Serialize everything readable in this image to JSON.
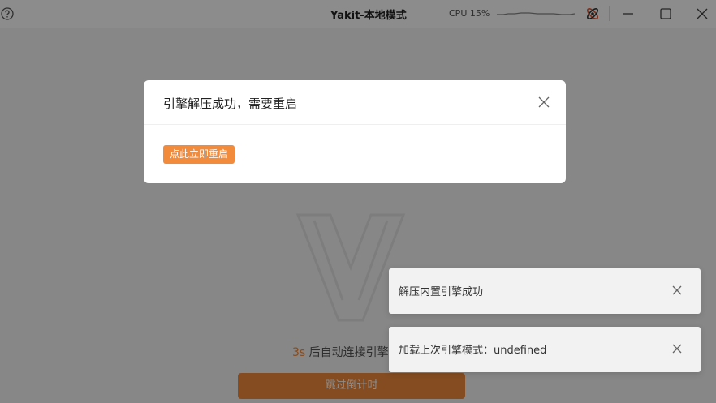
{
  "titlebar": {
    "app_title": "Yakit-本地模式",
    "cpu_label": "CPU 15%",
    "icons": {
      "help": "help-circle-icon",
      "engine": "engine-status-icon",
      "minimize": "minimize-icon",
      "maximize": "maximize-icon",
      "close": "close-icon"
    }
  },
  "background": {
    "countdown_number": "3s",
    "countdown_text": " 后自动连接引擎",
    "skip_label": "跳过倒计时"
  },
  "modal": {
    "title": "引擎解压成功，需要重启",
    "restart_label": "点此立即重启"
  },
  "notifications": [
    {
      "text": "解压内置引擎成功"
    },
    {
      "text": "加载上次引擎模式：undefined"
    }
  ],
  "colors": {
    "accent": "#f28b3c",
    "overlay": "rgba(0,0,0,0.45)"
  }
}
